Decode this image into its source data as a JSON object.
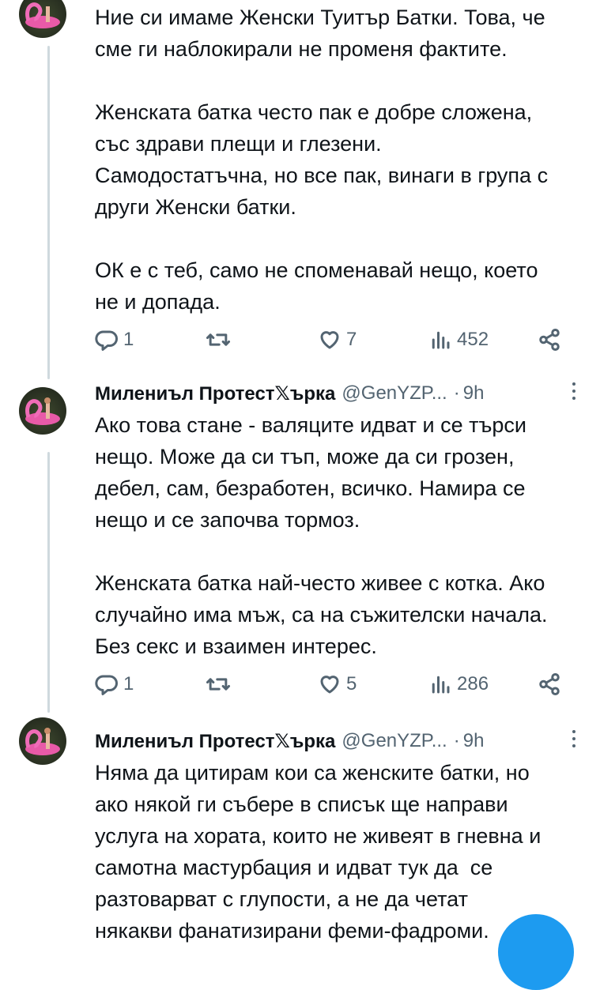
{
  "colors": {
    "accent": "#1d9bf0",
    "text": "#0f1419",
    "muted": "#536471",
    "thread_line": "#cfd9de"
  },
  "tweets": [
    {
      "paragraphs": [
        "Ние си имаме Женски Туитър Батки. Това, че\nсме ги наблокирали не променя фактите.",
        "Женската батка често пак е добре сложена,\nсъс здрави плещи и глезени.\nСамодостатъчна, но все пак, винаги в група с\nдруги Женски батки.",
        "ОК е с теб, само не споменавай нещо, което\nне и допада."
      ],
      "replies": "1",
      "likes": "7",
      "views": "452"
    },
    {
      "author": "Милениъл Протест𝕏ърка",
      "handle": "@GenYZP...",
      "dot": "·",
      "time": "9h",
      "paragraphs": [
        "Ако това стане - валяците идват и се търси\nнещо. Може да си тъп, може да си грозен,\nдебел, сам, безработен, всичко. Намира се\nнещо и се започва тормоз.",
        "Женската батка най-често живее с котка. Ако\nслучайно има мъж, са на съжителски начала.\nБез секс и взаимен интерес."
      ],
      "replies": "1",
      "likes": "5",
      "views": "286"
    },
    {
      "author": "Милениъл Протест𝕏ърка",
      "handle": "@GenYZP...",
      "dot": "·",
      "time": "9h",
      "paragraphs": [
        "Няма да цитирам кои са женските батки, но\nако някой ги събере в списък ще направи\nуслуга на хората, които не живеят в гневна и\nсамотна мастурбация и идват тук да  се\nразтоварват с глупости, а не да четат\nнякакви фанатизирани феми-фадроми."
      ]
    }
  ],
  "icons": [
    "reply-icon",
    "retweet-icon",
    "like-icon",
    "views-icon",
    "share-icon",
    "more-icon"
  ]
}
